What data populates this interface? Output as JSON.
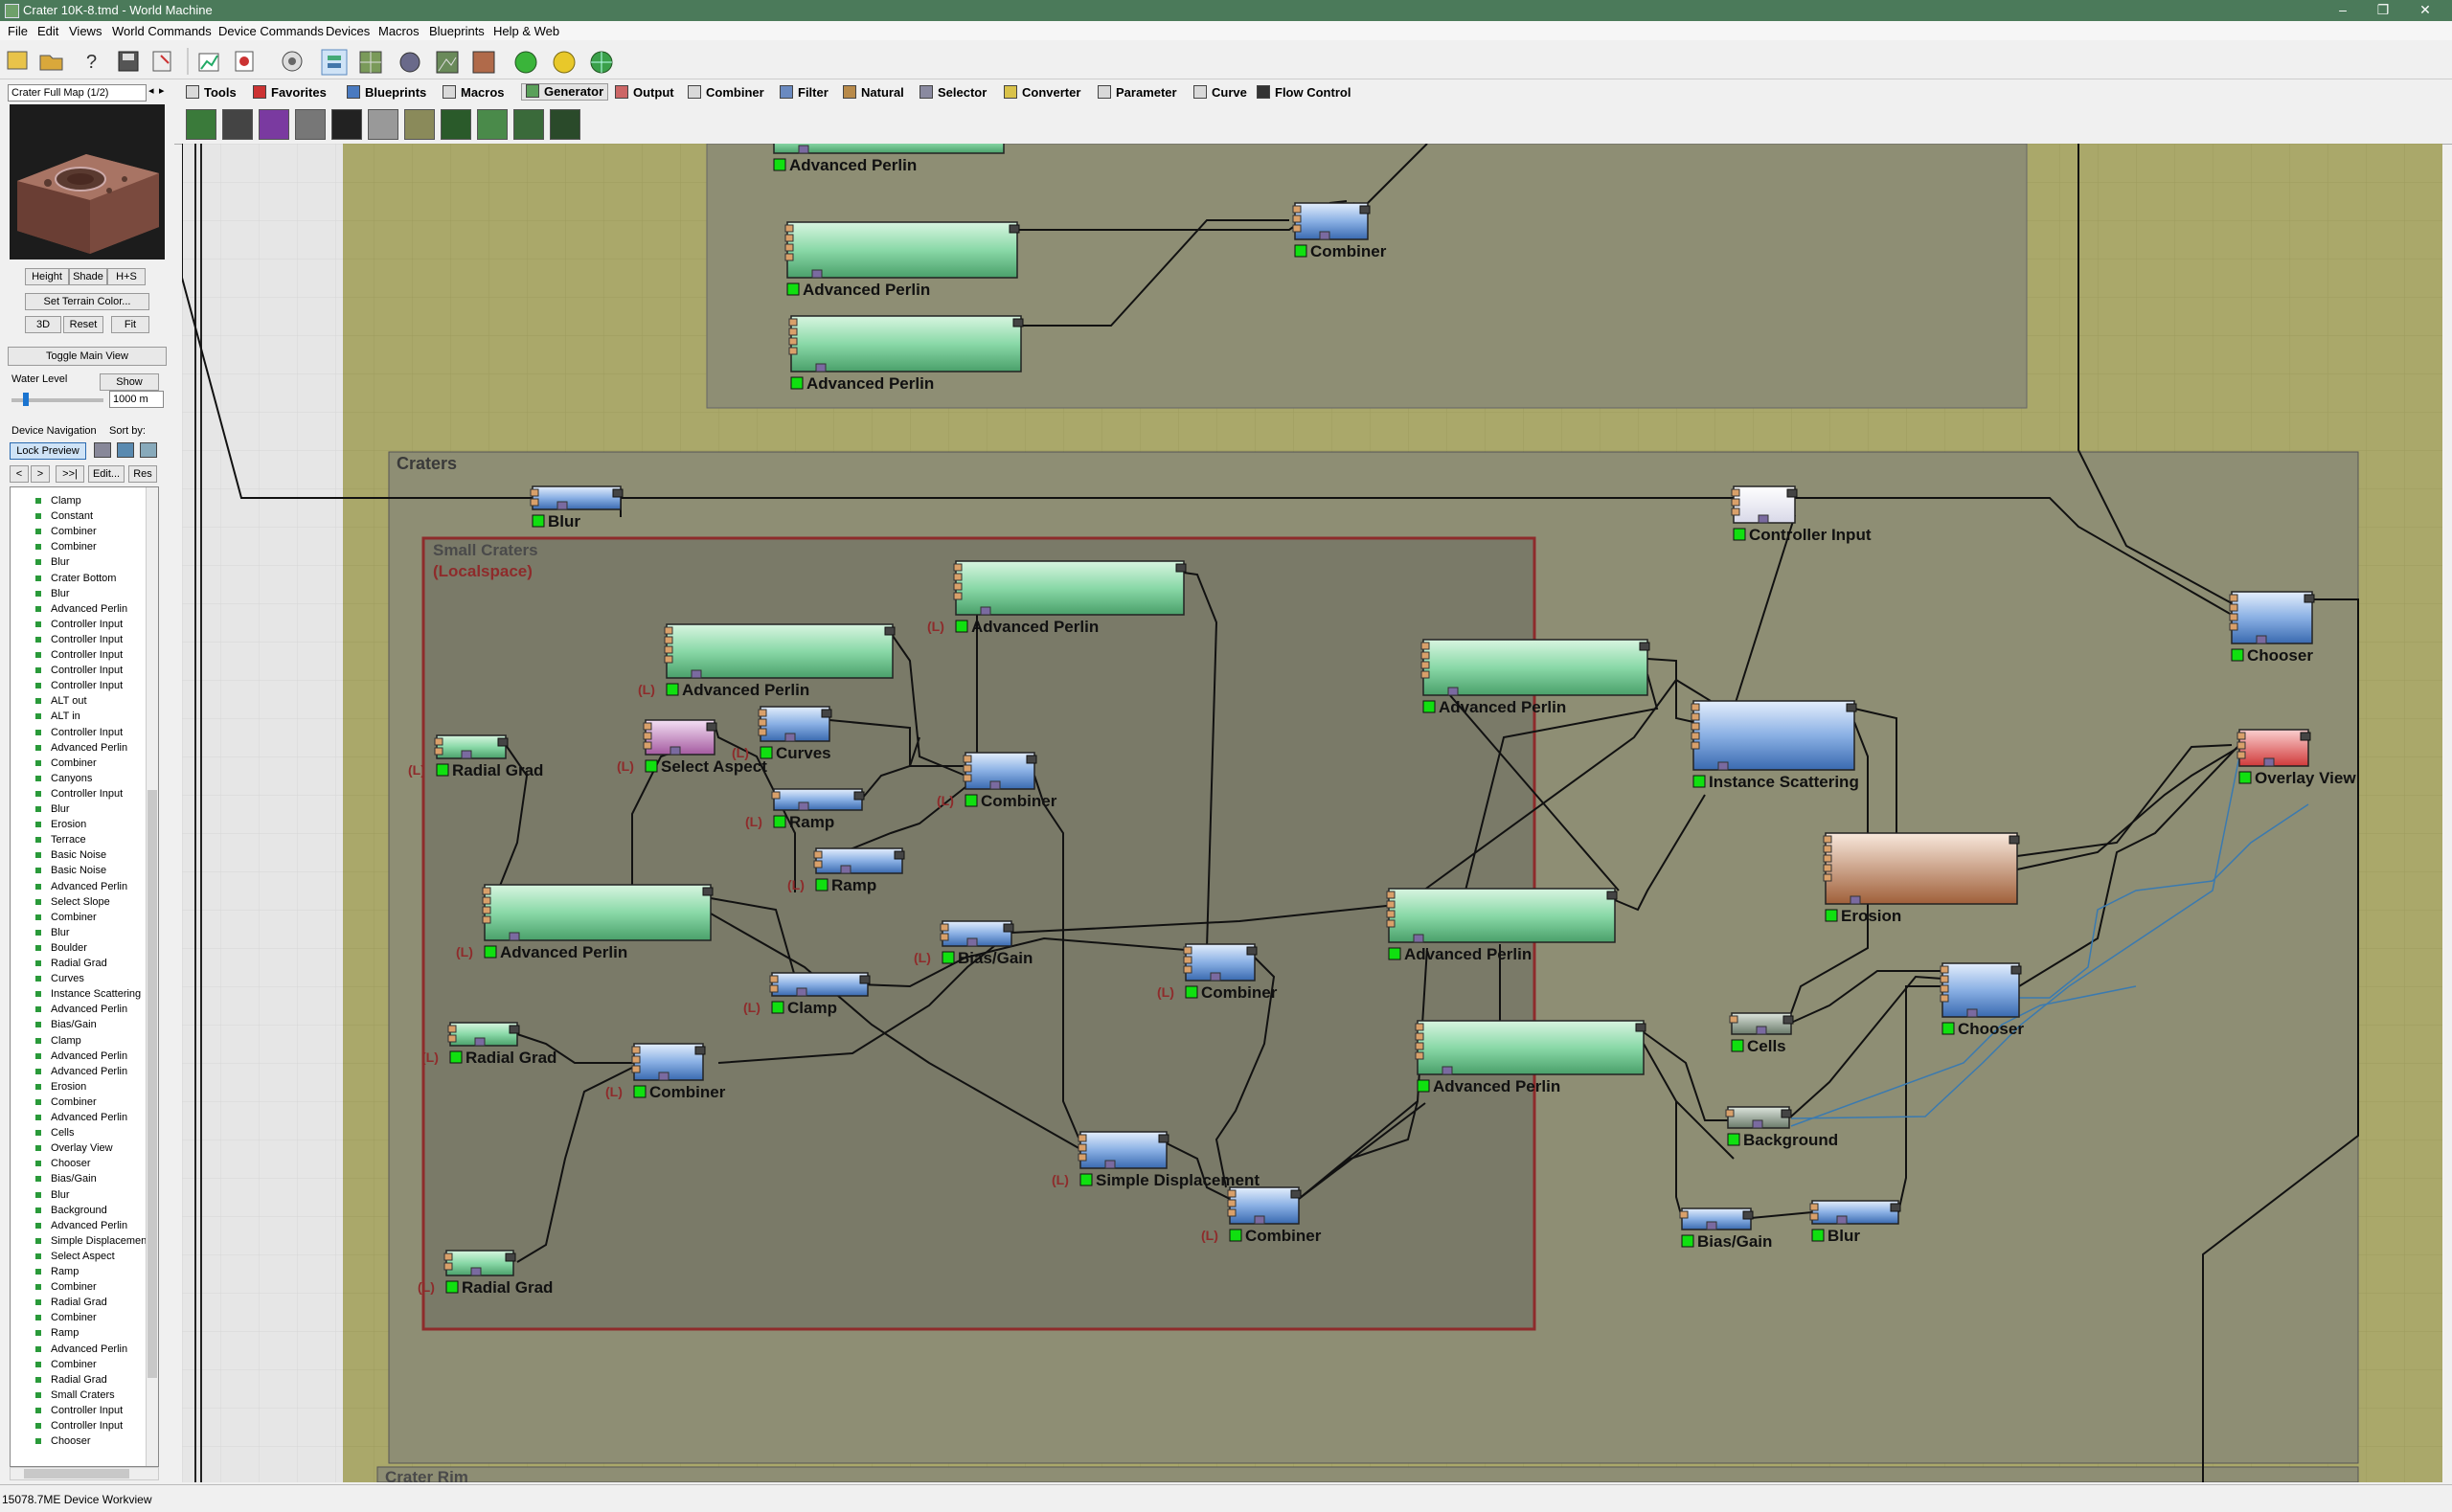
{
  "window": {
    "title": "Crater 10K-8.tmd - World Machine",
    "controls": [
      "–",
      "❐",
      "✕"
    ]
  },
  "menu": [
    "File",
    "Edit",
    "Views",
    "World Commands",
    "Device Commands",
    "Devices",
    "Macros",
    "Blueprints",
    "Help & Web"
  ],
  "preview": {
    "selector": "Crater Full Map (1/2)",
    "modes": [
      "Height",
      "Shade",
      "H+S"
    ],
    "set_color": "Set Terrain Color...",
    "view_btns": [
      "3D",
      "Reset",
      "Fit"
    ],
    "toggle_main": "Toggle Main View",
    "water_label": "Water Level",
    "water_show": "Show",
    "water_value": "1000 m"
  },
  "navigation": {
    "title": "Device Navigation",
    "sort_label": "Sort by:",
    "lock": "Lock Preview",
    "arrows": [
      "<",
      ">",
      ">>|"
    ],
    "edit": "Edit...",
    "res": "Res",
    "items": [
      "Clamp",
      "Constant",
      "Combiner",
      "Combiner",
      "Blur",
      "Crater Bottom",
      "Blur",
      "Advanced Perlin",
      "Controller Input",
      "Controller Input",
      "Controller Input",
      "Controller Input",
      "Controller Input",
      "ALT out",
      "ALT in",
      "Controller Input",
      "Advanced Perlin",
      "Combiner",
      "Canyons",
      "Controller Input",
      "Blur",
      "Erosion",
      "Terrace",
      "Basic Noise",
      "Basic Noise",
      "Advanced Perlin",
      "Select Slope",
      "Combiner",
      "Blur",
      "Boulder",
      "Radial Grad",
      "Curves",
      "Instance Scattering",
      "Advanced Perlin",
      "Bias/Gain",
      "Clamp",
      "Advanced Perlin",
      "Advanced Perlin",
      "Erosion",
      "Combiner",
      "Advanced Perlin",
      "Cells",
      "Overlay View",
      "Chooser",
      "Bias/Gain",
      "Blur",
      "Background",
      "Advanced Perlin",
      "Simple Displacemen",
      "Select Aspect",
      "Ramp",
      "Combiner",
      "Radial Grad",
      "Combiner",
      "Ramp",
      "Advanced Perlin",
      "Combiner",
      "Radial Grad",
      "Small Craters",
      "Controller Input",
      "Controller Input",
      "Chooser"
    ]
  },
  "palette": {
    "tabs": [
      "Tools",
      "Favorites",
      "Blueprints",
      "Macros",
      "Generator",
      "Output",
      "Combiner",
      "Filter",
      "Natural",
      "Selector",
      "Converter",
      "Parameter",
      "Curve",
      "Flow Control"
    ],
    "active_tab": "Generator"
  },
  "graph": {
    "groups": {
      "craters": "Craters",
      "small_craters": "Small Craters",
      "localspace": "(Localspace)",
      "crater_rim": "Crater Rim"
    },
    "local_prefix": "(L)",
    "nodes": [
      {
        "label": "Advanced Perlin",
        "kind": "green",
        "local": false
      },
      {
        "label": "Advanced Perlin",
        "kind": "green",
        "local": false
      },
      {
        "label": "Advanced Perlin",
        "kind": "green",
        "local": false
      },
      {
        "label": "Combiner",
        "kind": "blue",
        "local": false
      },
      {
        "label": "Blur",
        "kind": "blue",
        "local": false
      },
      {
        "label": "Controller Input",
        "kind": "white",
        "local": false
      },
      {
        "label": "Chooser",
        "kind": "blue",
        "local": false
      },
      {
        "label": "Overlay View",
        "kind": "red",
        "local": false
      },
      {
        "label": "Advanced Perlin",
        "kind": "green",
        "local": true
      },
      {
        "label": "Advanced Perlin",
        "kind": "green",
        "local": true
      },
      {
        "label": "Radial Grad",
        "kind": "green",
        "local": true
      },
      {
        "label": "Select Aspect",
        "kind": "purple",
        "local": true
      },
      {
        "label": "Curves",
        "kind": "blue",
        "local": true
      },
      {
        "label": "Combiner",
        "kind": "blue",
        "local": true
      },
      {
        "label": "Ramp",
        "kind": "blue",
        "local": true
      },
      {
        "label": "Ramp",
        "kind": "blue",
        "local": true
      },
      {
        "label": "Advanced Perlin",
        "kind": "green",
        "local": true
      },
      {
        "label": "Bias/Gain",
        "kind": "blue",
        "local": true
      },
      {
        "label": "Clamp",
        "kind": "blue",
        "local": true
      },
      {
        "label": "Combiner",
        "kind": "blue",
        "local": true
      },
      {
        "label": "Radial Grad",
        "kind": "green",
        "local": true
      },
      {
        "label": "Combiner",
        "kind": "blue",
        "local": true
      },
      {
        "label": "Simple Displacement",
        "kind": "blue",
        "local": true
      },
      {
        "label": "Combiner",
        "kind": "blue",
        "local": true
      },
      {
        "label": "Radial Grad",
        "kind": "green",
        "local": true
      },
      {
        "label": "Advanced Perlin",
        "kind": "green",
        "local": false
      },
      {
        "label": "Instance Scattering",
        "kind": "blue",
        "local": false
      },
      {
        "label": "Erosion",
        "kind": "brown",
        "local": false
      },
      {
        "label": "Advanced Perlin",
        "kind": "green",
        "local": false
      },
      {
        "label": "Advanced Perlin",
        "kind": "green",
        "local": false
      },
      {
        "label": "Cells",
        "kind": "gray",
        "local": false
      },
      {
        "label": "Chooser",
        "kind": "blue",
        "local": false
      },
      {
        "label": "Background",
        "kind": "gray",
        "local": false
      },
      {
        "label": "Bias/Gain",
        "kind": "blue",
        "local": false
      },
      {
        "label": "Blur",
        "kind": "blue",
        "local": false
      }
    ]
  },
  "status": {
    "text": "15078.7ME Device Workview"
  },
  "colors": {
    "titlebar": "#4b7a5a",
    "canvas_bg": "#aaa86a",
    "group_bg": "#8e8e74",
    "small_group_border": "#8e2b2b"
  }
}
